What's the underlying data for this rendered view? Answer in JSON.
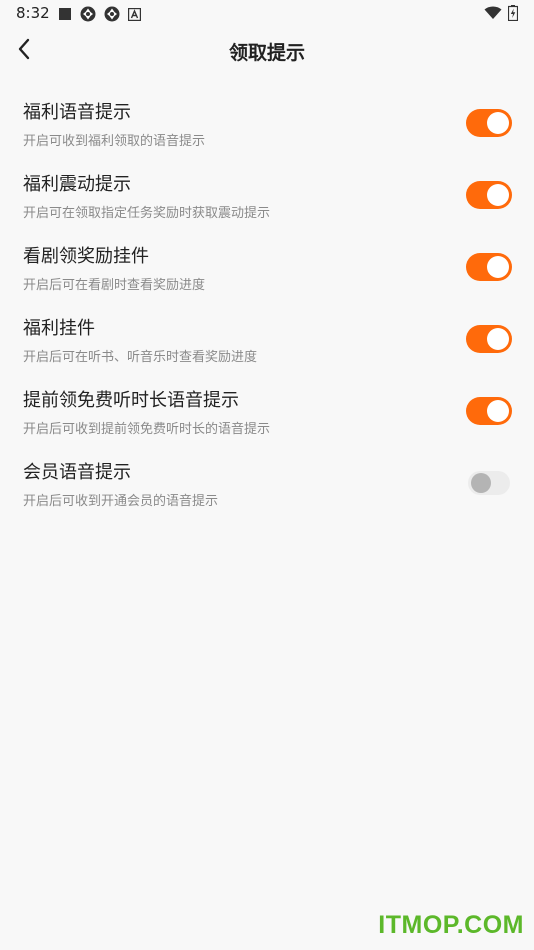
{
  "status_bar": {
    "time": "8:32",
    "icons": [
      "stop-square-icon",
      "aperture-icon",
      "aperture-icon",
      "a-badge-icon"
    ],
    "right_icons": [
      "wifi-icon",
      "battery-charging-icon"
    ]
  },
  "header": {
    "back_icon": "chevron-left-icon",
    "title": "领取提示"
  },
  "settings": [
    {
      "title": "福利语音提示",
      "description": "开启可收到福利领取的语音提示",
      "enabled": true
    },
    {
      "title": "福利震动提示",
      "description": "开启可在领取指定任务奖励时获取震动提示",
      "enabled": true
    },
    {
      "title": "看剧领奖励挂件",
      "description": "开启后可在看剧时查看奖励进度",
      "enabled": true
    },
    {
      "title": "福利挂件",
      "description": "开启后可在听书、听音乐时查看奖励进度",
      "enabled": true
    },
    {
      "title": "提前领免费听时长语音提示",
      "description": "开启后可收到提前领免费听时长的语音提示",
      "enabled": true
    },
    {
      "title": "会员语音提示",
      "description": "开启后可收到开通会员的语音提示",
      "enabled": false
    }
  ],
  "colors": {
    "toggle_on": "#ff6a0b",
    "toggle_off": "#ececec",
    "background": "#f8f8f8"
  },
  "watermark": "ITMOP.COM"
}
